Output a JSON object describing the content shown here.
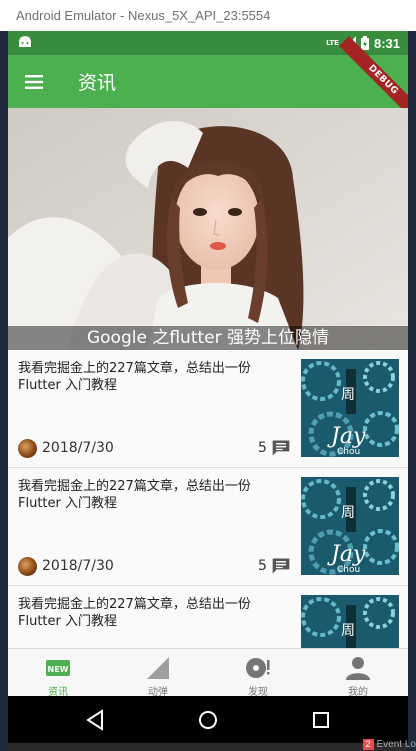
{
  "window": {
    "title": "Android Emulator - Nexus_5X_API_23:5554"
  },
  "status_bar": {
    "time": "8:31",
    "network": "LTE"
  },
  "app_bar": {
    "title": "资讯",
    "debug_ribbon": "DEBUG"
  },
  "banner": {
    "caption": "Google 之flutter 强势上位隐情"
  },
  "articles": [
    {
      "title": "我看完掘金上的227篇文章，总结出一份Flutter 入门教程",
      "date": "2018/7/30",
      "comments": "5",
      "thumb_text": "Jay",
      "thumb_sub": "Chou"
    },
    {
      "title": "我看完掘金上的227篇文章，总结出一份Flutter 入门教程",
      "date": "2018/7/30",
      "comments": "5",
      "thumb_text": "Jay",
      "thumb_sub": "Chou"
    },
    {
      "title": "我看完掘金上的227篇文章，总结出一份Flutter 入门教程",
      "date": "",
      "comments": "",
      "thumb_text": "",
      "thumb_sub": ""
    }
  ],
  "bottom_nav": [
    {
      "label": "资讯",
      "icon": "new-badge-icon",
      "active": true,
      "badge_text": "NEW"
    },
    {
      "label": "动弹",
      "icon": "triangle-icon",
      "active": false
    },
    {
      "label": "发现",
      "icon": "discover-icon",
      "active": false
    },
    {
      "label": "我的",
      "icon": "person-icon",
      "active": false
    }
  ],
  "ide": {
    "event_log_badge": "2",
    "event_log": "Event Lo"
  },
  "colors": {
    "primary": "#4caf50",
    "primary_dark": "#388e3c",
    "debug": "#a42424"
  }
}
